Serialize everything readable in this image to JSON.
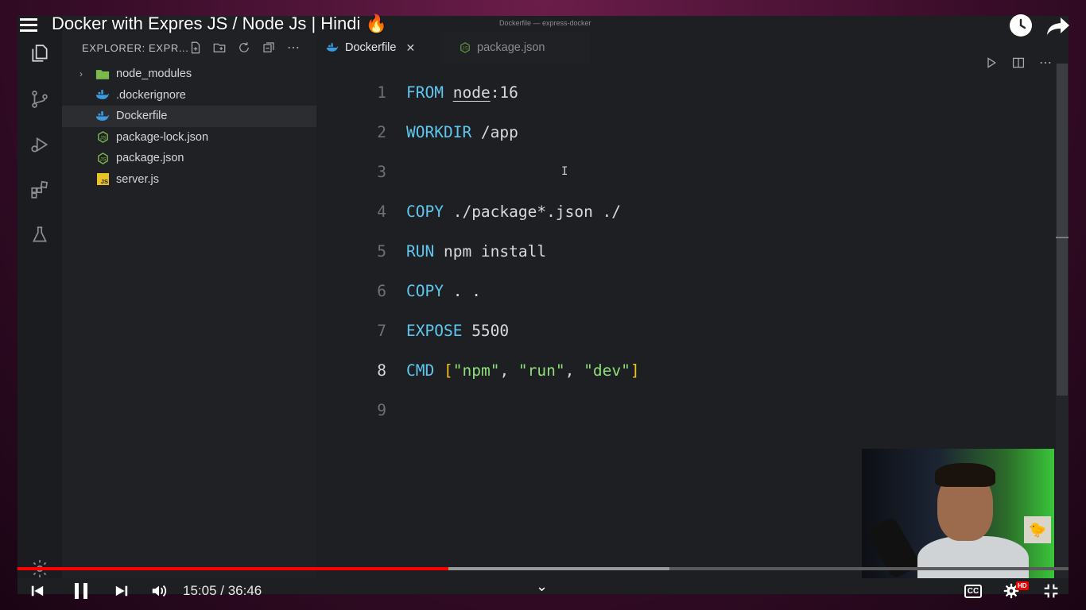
{
  "video": {
    "title": "Docker with Expres JS / Node Js | Hindi 🔥",
    "time_current": "15:05",
    "time_total": "36:46",
    "time_display": "15:05 / 36:46",
    "progress_fraction": 0.41,
    "buffer_fraction": 0.62,
    "cc_label": "CC",
    "hd_badge": "HD"
  },
  "window": {
    "title": "Dockerfile — express-docker"
  },
  "sidebar": {
    "title": "EXPLORER: EXPR...",
    "items": [
      {
        "name": "node_modules",
        "icon": "folder-icon",
        "expandable": true,
        "selected": false
      },
      {
        "name": ".dockerignore",
        "icon": "docker-icon",
        "expandable": false,
        "selected": false
      },
      {
        "name": "Dockerfile",
        "icon": "docker-icon",
        "expandable": false,
        "selected": true
      },
      {
        "name": "package-lock.json",
        "icon": "nodejs-icon",
        "expandable": false,
        "selected": false
      },
      {
        "name": "package.json",
        "icon": "nodejs-icon",
        "expandable": false,
        "selected": false
      },
      {
        "name": "server.js",
        "icon": "js-icon",
        "expandable": false,
        "selected": false
      }
    ]
  },
  "tabs": [
    {
      "label": "Dockerfile",
      "active": true
    },
    {
      "label": "package.json",
      "active": false
    }
  ],
  "editor": {
    "active_line": 8,
    "lines": [
      {
        "n": "1",
        "kw": "FROM",
        "rest_u": "node",
        "rest": ":16"
      },
      {
        "n": "2",
        "kw": "WORKDIR",
        "rest": " /app"
      },
      {
        "n": "3",
        "kw": "",
        "rest": ""
      },
      {
        "n": "4",
        "kw": "COPY",
        "rest": " ./package*.json ./"
      },
      {
        "n": "5",
        "kw": "RUN",
        "rest": " npm install"
      },
      {
        "n": "6",
        "kw": "COPY",
        "rest": " . ."
      },
      {
        "n": "7",
        "kw": "EXPOSE",
        "rest": " 5500"
      },
      {
        "n": "8",
        "kw": "CMD",
        "args": [
          "\"npm\"",
          "\"run\"",
          "\"dev\""
        ]
      },
      {
        "n": "9",
        "kw": "",
        "rest": ""
      }
    ]
  },
  "colors": {
    "keyword": "#5ec7ef",
    "string": "#8ee07a",
    "bracket": "#f1c21b",
    "progress": "#ff0000"
  }
}
